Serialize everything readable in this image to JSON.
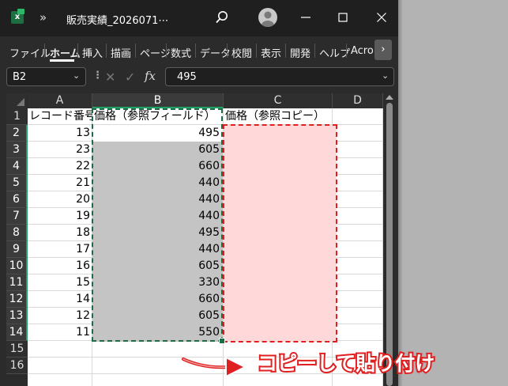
{
  "window": {
    "title": "販売実績_2026071⋯",
    "overflow_glyph": "»"
  },
  "ribbon": {
    "tabs": [
      "ファイル",
      "ホーム",
      "挿入",
      "描画",
      "ページ",
      "数式",
      "データ",
      "校閲",
      "表示",
      "開発",
      "ヘルプ",
      "Acro"
    ],
    "active_tab": "ホーム",
    "scroll_glyph": "›"
  },
  "formula_bar": {
    "name_box": "B2",
    "fx_label": "fx",
    "value": "495"
  },
  "sheet": {
    "columns": [
      "A",
      "B",
      "C",
      "D"
    ],
    "selected_column": "B",
    "rows": [
      "1",
      "2",
      "3",
      "4",
      "5",
      "6",
      "7",
      "8",
      "9",
      "10",
      "11",
      "12",
      "13",
      "14",
      "15",
      "16"
    ],
    "headers": {
      "A1": "レコード番号",
      "B1": "価格（参照フィールド）",
      "C1": "価格（参照コピー）"
    },
    "record_numbers": [
      "13",
      "23",
      "22",
      "21",
      "20",
      "19",
      "18",
      "17",
      "16",
      "15",
      "14",
      "12",
      "11"
    ],
    "prices": [
      "495",
      "605",
      "660",
      "440",
      "440",
      "440",
      "495",
      "440",
      "605",
      "330",
      "660",
      "605",
      "550"
    ]
  },
  "annotation": {
    "text": "コピーして貼り付け",
    "accent_color": "#e02020"
  },
  "colors": {
    "copy_border": "#1e6b45",
    "paste_fill": "#ffd9d9",
    "selection_fill": "#c4c4c4"
  }
}
